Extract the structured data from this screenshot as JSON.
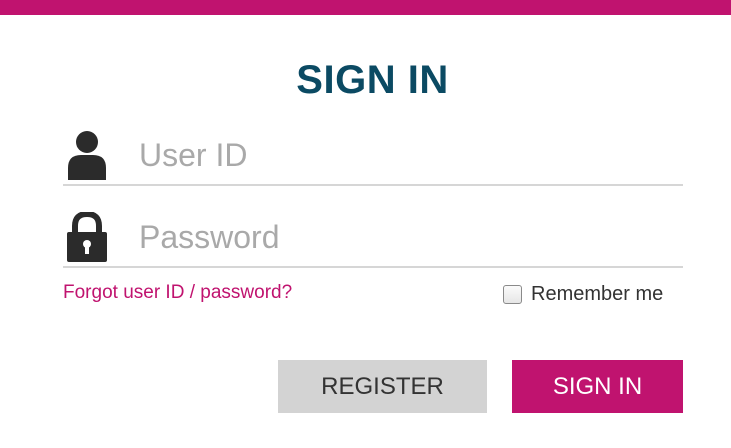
{
  "colors": {
    "brand": "#c0136f",
    "title": "#0b4a63",
    "icon": "#2b2b2b",
    "register_bg": "#d3d3d3"
  },
  "header": {
    "title": "SIGN IN"
  },
  "form": {
    "user_field": {
      "icon": "user-icon",
      "placeholder": "User ID",
      "value": ""
    },
    "password_field": {
      "icon": "lock-icon",
      "placeholder": "Password",
      "value": ""
    },
    "forgot_link": "Forgot user ID / password?",
    "remember_me": {
      "label": "Remember me",
      "checked": false
    }
  },
  "buttons": {
    "register_label": "REGISTER",
    "signin_label": "SIGN IN"
  }
}
